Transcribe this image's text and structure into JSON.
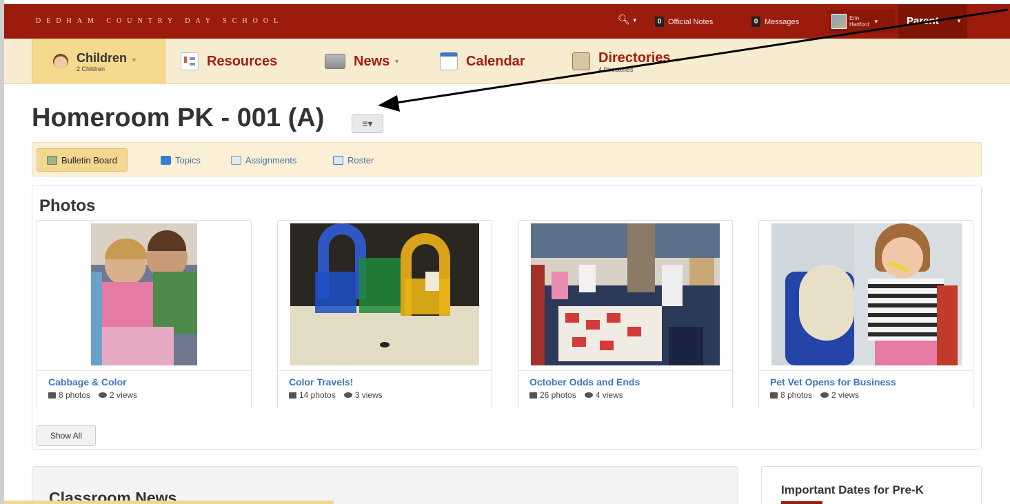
{
  "topbar": {
    "school_name": "DEDHAM COUNTRY DAY SCHOOL",
    "search_icon": "search-icon",
    "official_notes_count": "0",
    "official_notes_label": "Official Notes",
    "messages_count": "0",
    "messages_label": "Messages",
    "user_first": "Erin",
    "user_last": "Hartford",
    "role_label": "Parent",
    "colors": {
      "bar": "#9b1c0c",
      "role": "#7d1606"
    }
  },
  "nav": {
    "items": [
      {
        "label": "Children",
        "sub": "2 Children",
        "icon": "child-face-icon"
      },
      {
        "label": "Resources",
        "sub": "",
        "icon": "resources-icon"
      },
      {
        "label": "News",
        "sub": "",
        "icon": "news-icon"
      },
      {
        "label": "Calendar",
        "sub": "",
        "icon": "calendar-icon"
      },
      {
        "label": "Directories",
        "sub": "4 Directories",
        "icon": "directory-icon"
      }
    ]
  },
  "page": {
    "title": "Homeroom PK - 001 (A)",
    "menu_icon": "list-menu-icon"
  },
  "subnav": {
    "items": [
      {
        "label": "Bulletin Board",
        "icon": "bulletin-icon"
      },
      {
        "label": "Topics",
        "icon": "topics-icon"
      },
      {
        "label": "Assignments",
        "icon": "assignments-icon"
      },
      {
        "label": "Roster",
        "icon": "roster-icon"
      }
    ]
  },
  "photos": {
    "title": "Photos",
    "albums": [
      {
        "title": "Cabbage & Color",
        "photos": "8 photos",
        "views": "2 views"
      },
      {
        "title": "Color Travels!",
        "photos": "14 photos",
        "views": "3 views"
      },
      {
        "title": "October Odds and Ends",
        "photos": "26 photos",
        "views": "4 views"
      },
      {
        "title": "Pet Vet Opens for Business",
        "photos": "8 photos",
        "views": "2 views"
      }
    ],
    "show_all": "Show All"
  },
  "classroom_news": {
    "title": "Classroom News"
  },
  "important_dates": {
    "title": "Important Dates for Pre-K"
  }
}
